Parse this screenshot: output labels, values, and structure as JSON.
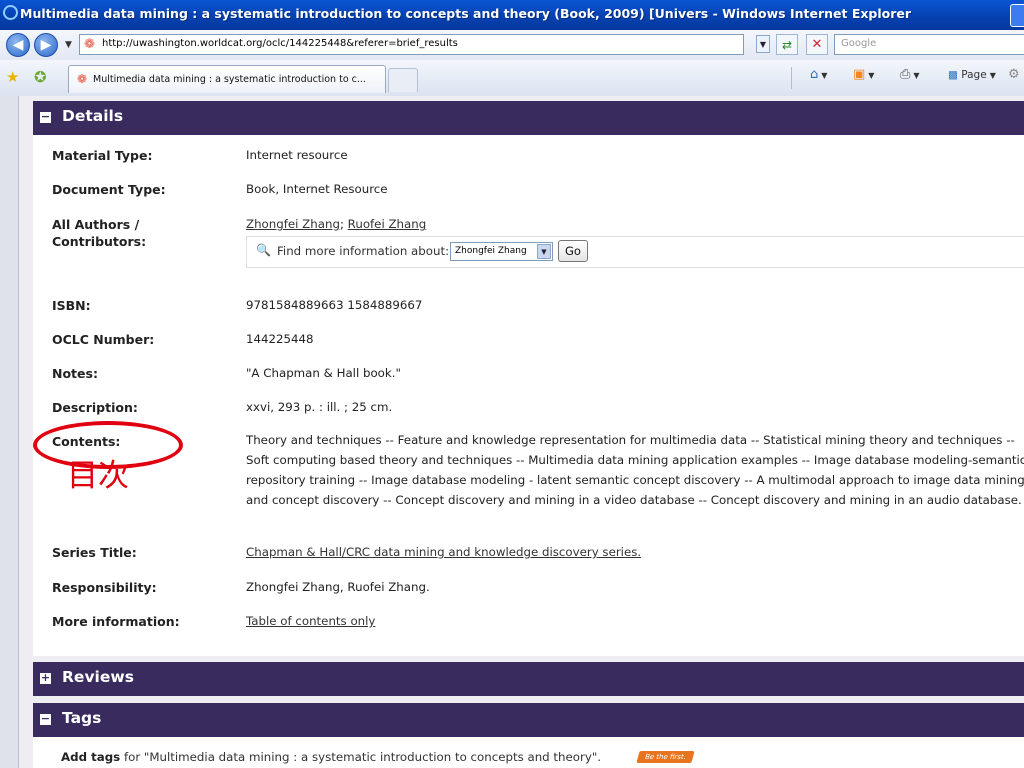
{
  "window": {
    "title": "Multimedia data mining : a systematic introduction to concepts and theory (Book, 2009) [Univers - Windows Internet Explorer"
  },
  "browser": {
    "back_icon": "back-arrow-icon",
    "forward_icon": "forward-arrow-icon",
    "url": "http://uwashington.worldcat.org/oclc/144225448&referer=brief_results",
    "search_placeholder": "Google",
    "tab_title": "Multimedia data mining : a systematic introduction to c...",
    "toolbar": {
      "page_label": "Page"
    }
  },
  "details": {
    "heading": "Details",
    "material_type": {
      "label": "Material Type:",
      "value": "Internet resource"
    },
    "document_type": {
      "label": "Document Type:",
      "value": "Book, Internet Resource"
    },
    "authors": {
      "label": "All Authors / Contributors:",
      "author1": "Zhongfei Zhang",
      "separator": ";",
      "author2": "Ruofei Zhang",
      "find_more": "Find more information about:",
      "selected_author": "Zhongfei Zhang",
      "go_label": "Go"
    },
    "isbn": {
      "label": "ISBN:",
      "value": "9781584889663 1584889667"
    },
    "oclc": {
      "label": "OCLC Number:",
      "value": "144225448"
    },
    "notes": {
      "label": "Notes:",
      "value": "\"A Chapman & Hall book.\""
    },
    "description": {
      "label": "Description:",
      "value": "xxvi, 293 p. : ill. ; 25 cm."
    },
    "contents": {
      "label": "Contents:",
      "value": "Theory and techniques -- Feature and knowledge representation for multimedia data -- Statistical mining theory and techniques -- Soft computing based theory and techniques -- Multimedia data mining application examples -- Image database modeling-semantic repository training -- Image database modeling - latent semantic concept discovery -- A multimodal approach to image data mining and concept discovery -- Concept discovery and mining in a video database -- Concept discovery and mining in an audio database."
    },
    "series": {
      "label": "Series Title:",
      "value": "Chapman & Hall/CRC data mining and knowledge discovery series."
    },
    "responsibility": {
      "label": "Responsibility:",
      "value": "Zhongfei Zhang, Ruofei Zhang."
    },
    "more_info": {
      "label": "More information:",
      "value": "Table of contents only"
    }
  },
  "annotation": {
    "text": "目次",
    "color": "#e0000f"
  },
  "reviews": {
    "heading": "Reviews"
  },
  "tags": {
    "heading": "Tags",
    "add_tags_bold": "Add tags",
    "add_tags_rest": "for \"Multimedia data mining : a systematic introduction to concepts and theory\".",
    "badge": "Be the first."
  },
  "colors": {
    "section_bar": "#3a2b5f",
    "panel_bg": "#eeeef2"
  }
}
